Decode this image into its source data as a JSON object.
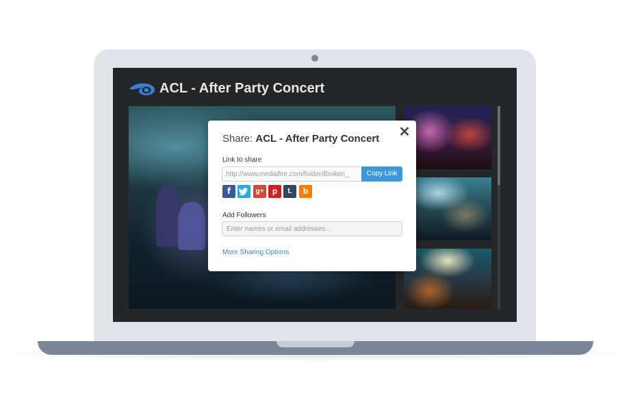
{
  "app": {
    "title": "ACL - After Party Concert",
    "logo_icon": "mediafire-flame-icon",
    "accent_color": "#3d97db"
  },
  "share_dialog": {
    "title_prefix": "Share:",
    "title_name": "ACL - After Party Concert",
    "close_label": "✕",
    "link_label": "Link to share",
    "link_value": "http://www.medaifire.com/folder/Broken_",
    "copy_button_label": "Copy Link",
    "social_buttons": [
      {
        "name": "facebook",
        "glyph": "f",
        "color": "#3b5998"
      },
      {
        "name": "twitter",
        "glyph": "t",
        "color": "#2ba9e1"
      },
      {
        "name": "google-plus",
        "glyph": "g+",
        "color": "#d34836"
      },
      {
        "name": "pinterest",
        "glyph": "p",
        "color": "#cb2027"
      },
      {
        "name": "tumblr",
        "glyph": "t.",
        "color": "#35465c"
      },
      {
        "name": "blogger",
        "glyph": "b",
        "color": "#f57d00"
      }
    ],
    "followers_label": "Add Followers",
    "followers_placeholder": "Enter names or email addresses...",
    "more_options_label": "More Sharing Options"
  }
}
